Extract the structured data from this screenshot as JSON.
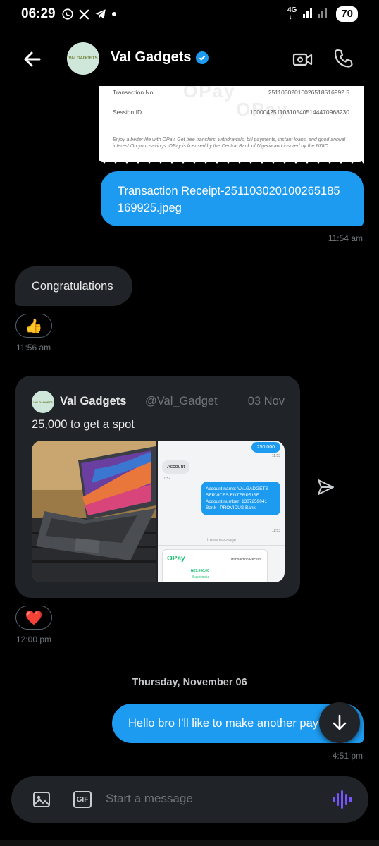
{
  "status_bar": {
    "time": "06:29",
    "network": "4G",
    "battery": "70",
    "icons": [
      "whatsapp-icon",
      "x-icon",
      "telegram-icon",
      "dot-icon"
    ]
  },
  "header": {
    "title": "Val Gadgets",
    "avatar_text": "VALGADGETS",
    "verified": true
  },
  "receipt": {
    "watermark": "OPay",
    "rows": [
      {
        "label": "Transaction No.",
        "value": "25110302010026518516992 5"
      },
      {
        "label": "Session ID",
        "value": "100004251103105405144470968230"
      }
    ],
    "footer": "Enjoy a better life with OPay. Get free transfers, withdrawals, bill payments, instant loans, and good annual interest On your savings. OPay is licensed by the Central Bank of Nigeria and insured by the NDIC."
  },
  "messages": {
    "attachment_text": "Transaction Receipt-251103020100265185169925.jpeg",
    "attachment_time": "11:54 am",
    "congrats_text": "Congratulations",
    "congrats_reaction": "👍",
    "congrats_time": "11:56 am",
    "card_reaction": "❤️",
    "card_time": "12:00 pm",
    "day_separator": "Thursday, November 06",
    "last_text": "Hello bro I'll like to make another pay",
    "last_time": "4:51 pm"
  },
  "shared_post": {
    "name": "Val Gadgets",
    "handle": "@Val_Gadget",
    "date": "03 Nov",
    "text": "25,000 to get a spot",
    "screenshot": {
      "amount_bubble": "250,000",
      "time1": "11:53",
      "account_label": "Account",
      "time2": "11:52",
      "account_info": "Account name: VALGADGETS SERVICES ENTERPRISE\nAccount number: 1307259041\nBank : PROVIDUS Bank",
      "time3": "11:53",
      "new_message": "1 new message",
      "opay_brand": "OPay",
      "receipt_label": "Transaction Receipt",
      "receipt_amount": "₦25,000.00",
      "receipt_status": "Successful"
    }
  },
  "composer": {
    "placeholder": "Start a message",
    "gif_label": "GIF"
  },
  "colors": {
    "accent": "#1d9bf0",
    "background": "#000000",
    "incoming": "#202327",
    "muted": "#71767b",
    "voice": "#7856ff"
  }
}
